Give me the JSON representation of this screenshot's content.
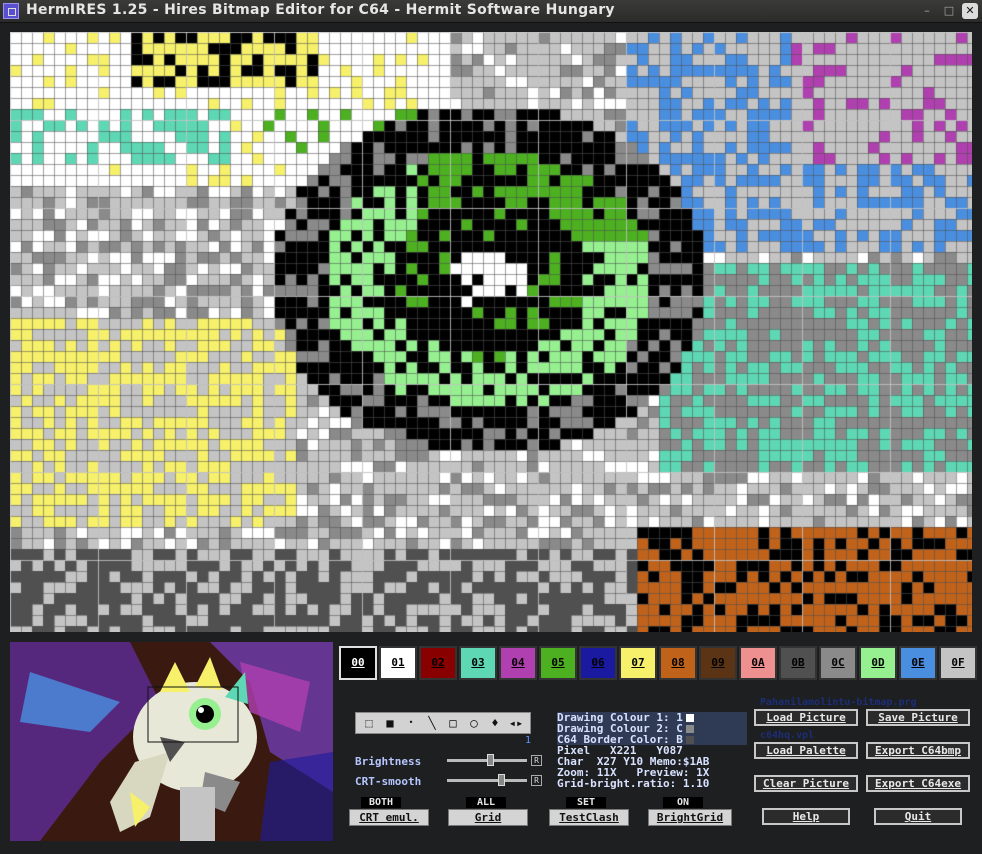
{
  "window": {
    "title": "HermIRES 1.25 - Hires Bitmap Editor for C64 - Hermit Software Hungary"
  },
  "palette": [
    {
      "label": "00",
      "color": "#000000",
      "text": "#ffffff",
      "selected": true
    },
    {
      "label": "01",
      "color": "#ffffff",
      "text": "#000000"
    },
    {
      "label": "02",
      "color": "#880000",
      "text": "#000000"
    },
    {
      "label": "03",
      "color": "#5ed8b4",
      "text": "#000000"
    },
    {
      "label": "04",
      "color": "#b040b0",
      "text": "#000000"
    },
    {
      "label": "05",
      "color": "#4cb020",
      "text": "#000000"
    },
    {
      "label": "06",
      "color": "#1a1aa0",
      "text": "#000000"
    },
    {
      "label": "07",
      "color": "#f6f06a",
      "text": "#000000"
    },
    {
      "label": "08",
      "color": "#c0621a",
      "text": "#000000"
    },
    {
      "label": "09",
      "color": "#5a3414",
      "text": "#000000"
    },
    {
      "label": "0A",
      "color": "#ee9090",
      "text": "#000000"
    },
    {
      "label": "0B",
      "color": "#505050",
      "text": "#000000"
    },
    {
      "label": "0C",
      "color": "#8a8a8a",
      "text": "#000000"
    },
    {
      "label": "0D",
      "color": "#96f090",
      "text": "#000000"
    },
    {
      "label": "0E",
      "color": "#4a8ee0",
      "text": "#000000"
    },
    {
      "label": "0F",
      "color": "#c4c4c4",
      "text": "#000000"
    }
  ],
  "tools": {
    "icons": [
      "select-rect-icon",
      "pen-icon",
      "dot-icon",
      "line-icon",
      "rectangle-icon",
      "circle-icon",
      "fill-icon",
      "mirror-icon"
    ],
    "selected_number": "1"
  },
  "sliders": {
    "brightness_label": "Brightness",
    "brightness_level": 0.55,
    "crt_smooth_label": "CRT-smooth",
    "crt_smooth_level": 0.7,
    "reset_label": "R"
  },
  "status": {
    "drawing_colour_1": "Drawing Colour 1: 1",
    "drawing_colour_2": "Drawing Colour 2: C",
    "border_color": "C64 Border Color: B",
    "pixel": "Pixel   X221   Y087",
    "char": "Char  X27 Y10 Memo:$1AB",
    "zoom": "Zoom: 11X   Preview: 1X",
    "grid_bright": "Grid-bright.ratio: 1.10",
    "colour_1_swatch": "#ffffff",
    "colour_2_swatch": "#8a8a8a",
    "border_swatch": "#505050"
  },
  "toggles": [
    {
      "state": "BOTH",
      "button": "CRT emul."
    },
    {
      "state": "ALL",
      "button": "Grid"
    },
    {
      "state": "SET",
      "button": "TestClash"
    },
    {
      "state": "ON",
      "button": "BrightGrid"
    }
  ],
  "files": {
    "picture_file": "Pahanilamolintu-bitmap.prg",
    "palette_file": "c64hq.vpl"
  },
  "actions": {
    "load_picture": "Load Picture",
    "save_picture": "Save Picture",
    "load_palette": "Load Palette",
    "export_bmp": "Export C64bmp",
    "clear_picture": "Clear Picture",
    "export_exe": "Export C64exe",
    "help": "Help",
    "quit": "Quit"
  }
}
